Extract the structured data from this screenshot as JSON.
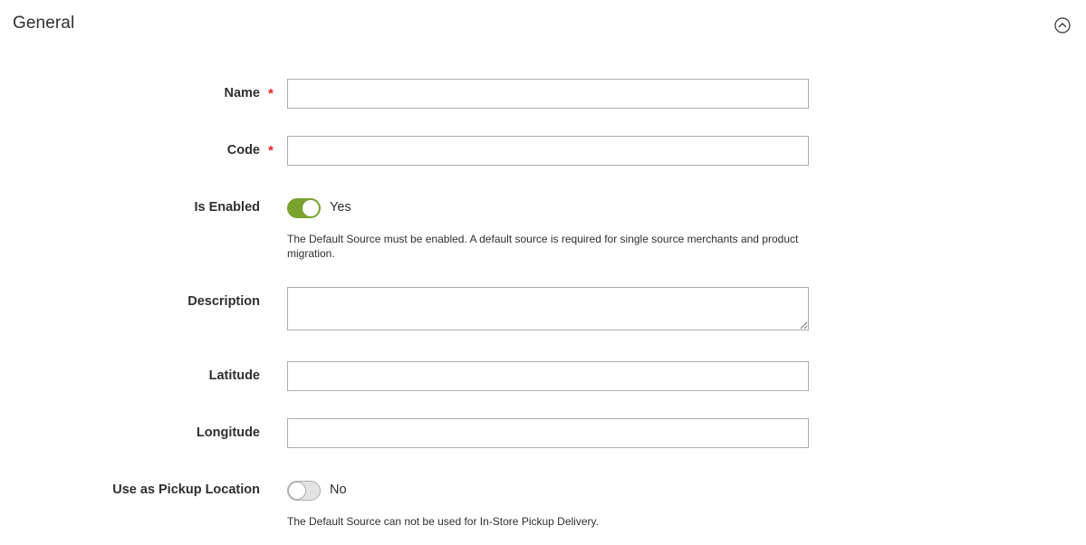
{
  "section": {
    "title": "General",
    "collapse_icon": "chevron-up-circle-icon"
  },
  "fields": {
    "name": {
      "label": "Name",
      "required_mark": "*",
      "value": ""
    },
    "code": {
      "label": "Code",
      "required_mark": "*",
      "value": ""
    },
    "is_enabled": {
      "label": "Is Enabled",
      "state": true,
      "state_text": "Yes",
      "note": "The Default Source must be enabled. A default source is required for single source merchants and product migration."
    },
    "description": {
      "label": "Description",
      "value": ""
    },
    "latitude": {
      "label": "Latitude",
      "value": ""
    },
    "longitude": {
      "label": "Longitude",
      "value": ""
    },
    "pickup_location": {
      "label": "Use as Pickup Location",
      "state": false,
      "state_text": "No",
      "note": "The Default Source can not be used for In-Store Pickup Delivery."
    }
  },
  "colors": {
    "toggle_on": "#79a22e",
    "required": "#e22626",
    "input_border": "#adadad",
    "text": "#303030"
  }
}
